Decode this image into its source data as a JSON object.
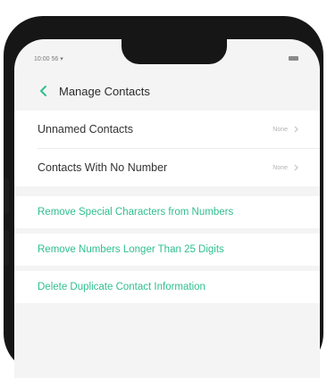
{
  "status_bar": {
    "time": "10:00 56 ▾"
  },
  "header": {
    "title": "Manage Contacts"
  },
  "settings": [
    {
      "label": "Unnamed Contacts",
      "value": "None"
    },
    {
      "label": "Contacts With No Number",
      "value": "None"
    }
  ],
  "actions": [
    {
      "label": "Remove Special Characters from Numbers"
    },
    {
      "label": "Remove Numbers Longer Than 25 Digits"
    },
    {
      "label": "Delete Duplicate Contact Information"
    }
  ],
  "colors": {
    "accent": "#2fbf8e",
    "frame": "#161616"
  }
}
